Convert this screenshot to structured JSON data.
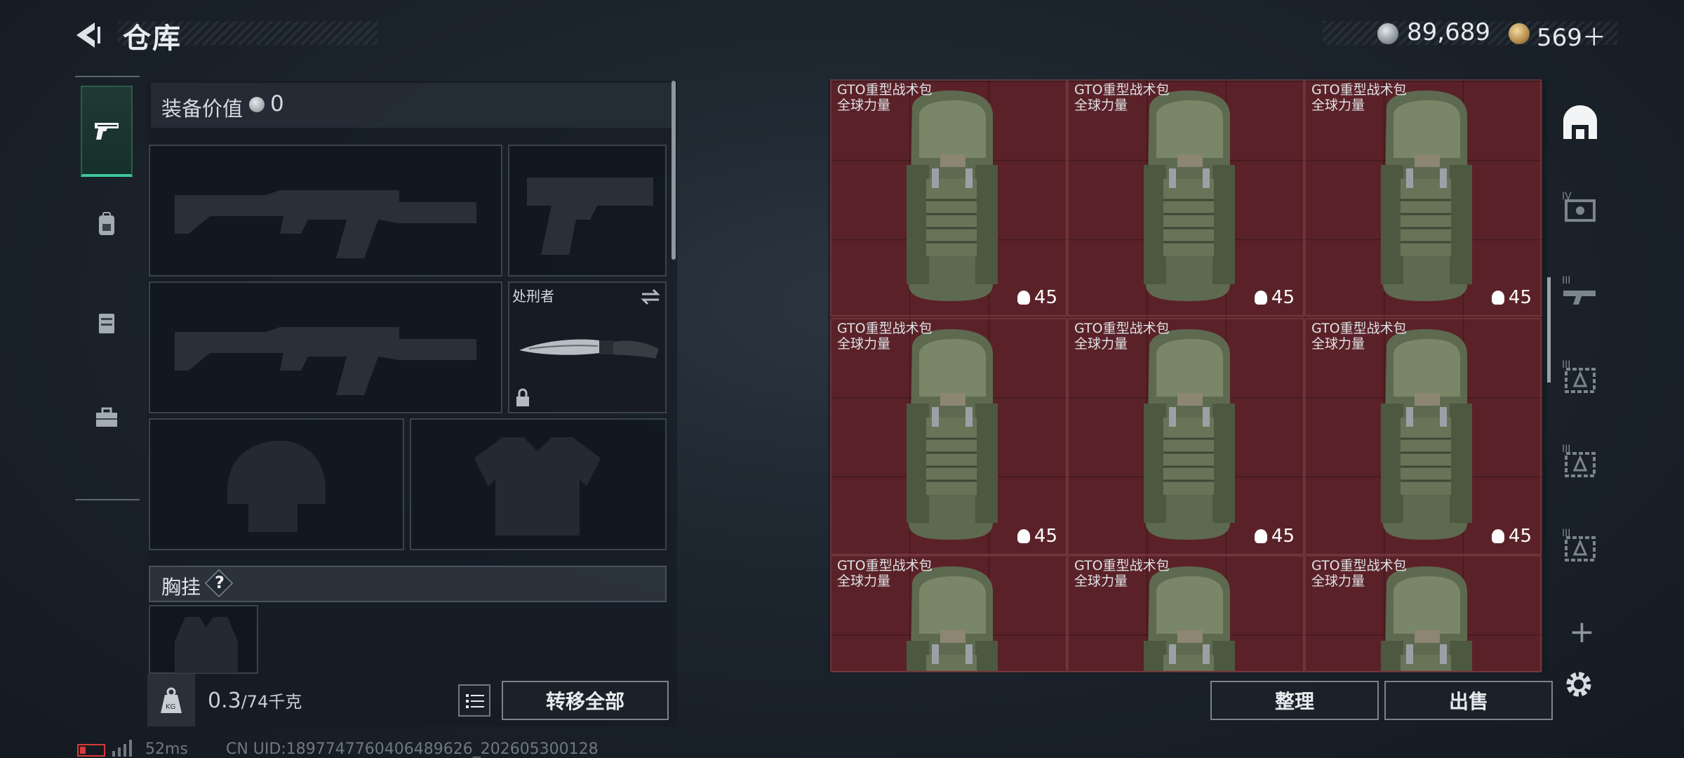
{
  "header": {
    "title": "仓库",
    "currency_silver": "89,689",
    "currency_gold": "569＋"
  },
  "equipment": {
    "value_label": "装备价值",
    "value": "0",
    "knife_name": "处刑者",
    "chest_label": "胸挂",
    "chest_help": "?"
  },
  "bottom_left": {
    "weight_current": "0.3",
    "weight_max": "/74千克",
    "transfer_all": "转移全部"
  },
  "status": {
    "ping": "52ms",
    "uid": "CN UID:1897747760406489626_202605300128"
  },
  "storage": {
    "items": [
      {
        "name": "GTO重型战术包",
        "sub": "全球力量",
        "count": "45"
      },
      {
        "name": "GTO重型战术包",
        "sub": "全球力量",
        "count": "45"
      },
      {
        "name": "GTO重型战术包",
        "sub": "全球力量",
        "count": "45"
      },
      {
        "name": "GTO重型战术包",
        "sub": "全球力量",
        "count": "45"
      },
      {
        "name": "GTO重型战术包",
        "sub": "全球力量",
        "count": "45"
      },
      {
        "name": "GTO重型战术包",
        "sub": "全球力量",
        "count": "45"
      },
      {
        "name": "GTO重型战术包",
        "sub": "全球力量",
        "count": ""
      },
      {
        "name": "GTO重型战术包",
        "sub": "全球力量",
        "count": ""
      },
      {
        "name": "GTO重型战术包",
        "sub": "全球力量",
        "count": ""
      }
    ],
    "right_rail_labels": [
      "IV",
      "III",
      "III",
      "III",
      "III"
    ]
  },
  "bottom_right": {
    "sort": "整理",
    "sell": "出售"
  }
}
